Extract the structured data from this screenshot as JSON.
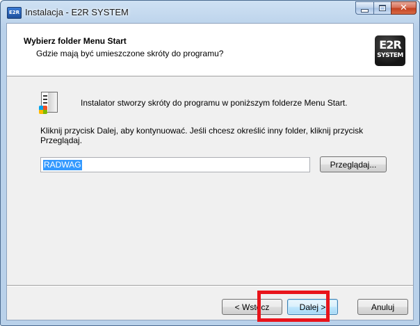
{
  "window": {
    "title": "Instalacja - E2R SYSTEM",
    "app_icon_label": "E2R"
  },
  "header": {
    "title": "Wybierz folder Menu Start",
    "subtitle": "Gdzie mają być umieszczone skróty do programu?",
    "logo_main": "E2R",
    "logo_sub": "SYSTEM"
  },
  "content": {
    "info": "Instalator stworzy skróty do programu w poniższym folderze Menu Start.",
    "instruction_line1": "Kliknij przycisk Dalej, aby kontynuować. Jeśli chcesz określić inny folder, kliknij przycisk",
    "instruction_line2": "Przeglądaj.",
    "folder_value": "RADWAG",
    "browse_label": "Przeglądaj..."
  },
  "footer": {
    "back_label": "< Wstecz",
    "next_label": "Dalej >",
    "cancel_label": "Anuluj"
  },
  "colors": {
    "highlight": "#e8141b",
    "selection": "#3399ff"
  }
}
